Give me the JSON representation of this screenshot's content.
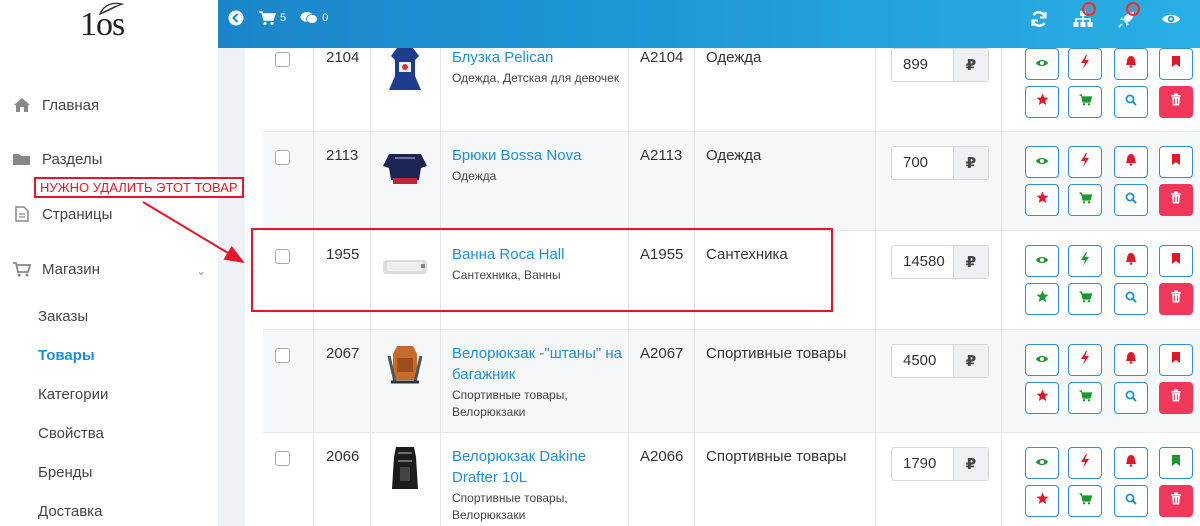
{
  "logo": {
    "text": "1os"
  },
  "topbar": {
    "cart_count": "5",
    "messages_count": "0"
  },
  "sidebar": {
    "items": [
      {
        "label": "Главная",
        "icon": "home-icon"
      },
      {
        "label": "Разделы",
        "icon": "folder-icon"
      },
      {
        "label": "Страницы",
        "icon": "page-icon"
      },
      {
        "label": "Магазин",
        "icon": "cart-icon"
      }
    ],
    "shop_items": [
      {
        "label": "Заказы",
        "active": false
      },
      {
        "label": "Товары",
        "active": true
      },
      {
        "label": "Категории",
        "active": false
      },
      {
        "label": "Свойства",
        "active": false
      },
      {
        "label": "Бренды",
        "active": false
      },
      {
        "label": "Доставка",
        "active": false
      }
    ]
  },
  "annotation": {
    "text": "НУЖНО УДАЛИТЬ ЭТОТ ТОВАР",
    "color": "#e3172a"
  },
  "currency_symbol": "₽",
  "products": [
    {
      "id": "2104",
      "title": "Блузка Pelican",
      "subtitle": "Одежда, Детская для девочек",
      "sku": "A2104",
      "category": "Одежда",
      "price": "899",
      "star_filled": false,
      "flash_filled": false,
      "bookmark_filled": false
    },
    {
      "id": "2113",
      "title": "Брюки Bossa Nova",
      "subtitle": "Одежда",
      "sku": "A2113",
      "category": "Одежда",
      "price": "700",
      "star_filled": false,
      "flash_filled": false,
      "bookmark_filled": false
    },
    {
      "id": "1955",
      "title": "Ванна Roca Hall",
      "subtitle": "Сантехника, Ванны",
      "sku": "A1955",
      "category": "Сантехника",
      "price": "14580",
      "star_filled": true,
      "flash_filled": true,
      "bookmark_filled": false
    },
    {
      "id": "2067",
      "title": "Велорюкзак -\"штаны\" на багажник",
      "subtitle": "Спортивные товары, Велорюкзаки",
      "sku": "A2067",
      "category": "Спортивные товары",
      "price": "4500",
      "star_filled": false,
      "flash_filled": false,
      "bookmark_filled": false
    },
    {
      "id": "2066",
      "title": "Велорюкзак Dakine Drafter 10L",
      "subtitle": "Спортивные товары, Велорюкзаки",
      "sku": "A2066",
      "category": "Спортивные товары",
      "price": "1790",
      "star_filled": false,
      "flash_filled": false,
      "bookmark_filled": true
    }
  ],
  "colors": {
    "accent": "#1d8fd8",
    "topbar": "#1a86c9",
    "danger": "#f2385a",
    "green": "#1a9a2e",
    "red": "#e3172a"
  }
}
